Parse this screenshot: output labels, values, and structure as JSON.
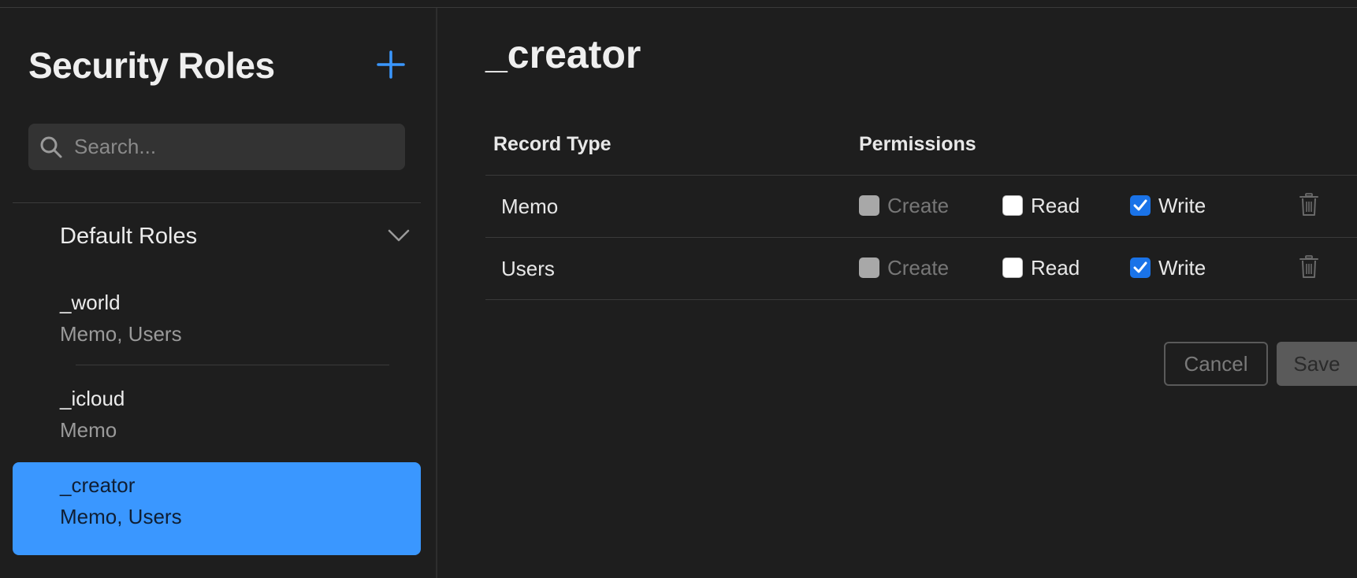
{
  "sidebar": {
    "title": "Security Roles",
    "search_placeholder": "Search...",
    "group_label": "Default Roles",
    "roles": [
      {
        "name": "_world",
        "types": "Memo, Users"
      },
      {
        "name": "_icloud",
        "types": "Memo"
      },
      {
        "name": "_creator",
        "types": "Memo, Users",
        "selected": true
      }
    ]
  },
  "main": {
    "title": "_creator",
    "columns": {
      "record_type": "Record Type",
      "permissions": "Permissions"
    },
    "rows": [
      {
        "record_type": "Memo",
        "create": "Create",
        "read": "Read",
        "write": "Write",
        "create_checked": false,
        "read_checked": false,
        "write_checked": true
      },
      {
        "record_type": "Users",
        "create": "Create",
        "read": "Read",
        "write": "Write",
        "create_checked": false,
        "read_checked": false,
        "write_checked": true
      }
    ],
    "cancel_label": "Cancel",
    "save_label": "Save"
  },
  "colors": {
    "accent": "#3a97ff",
    "background": "#1e1e1e",
    "checkbox_checked": "#1a73e8"
  },
  "icons": [
    "plus-icon",
    "search-icon",
    "chevron-down-icon",
    "checkmark-icon",
    "trash-icon"
  ]
}
